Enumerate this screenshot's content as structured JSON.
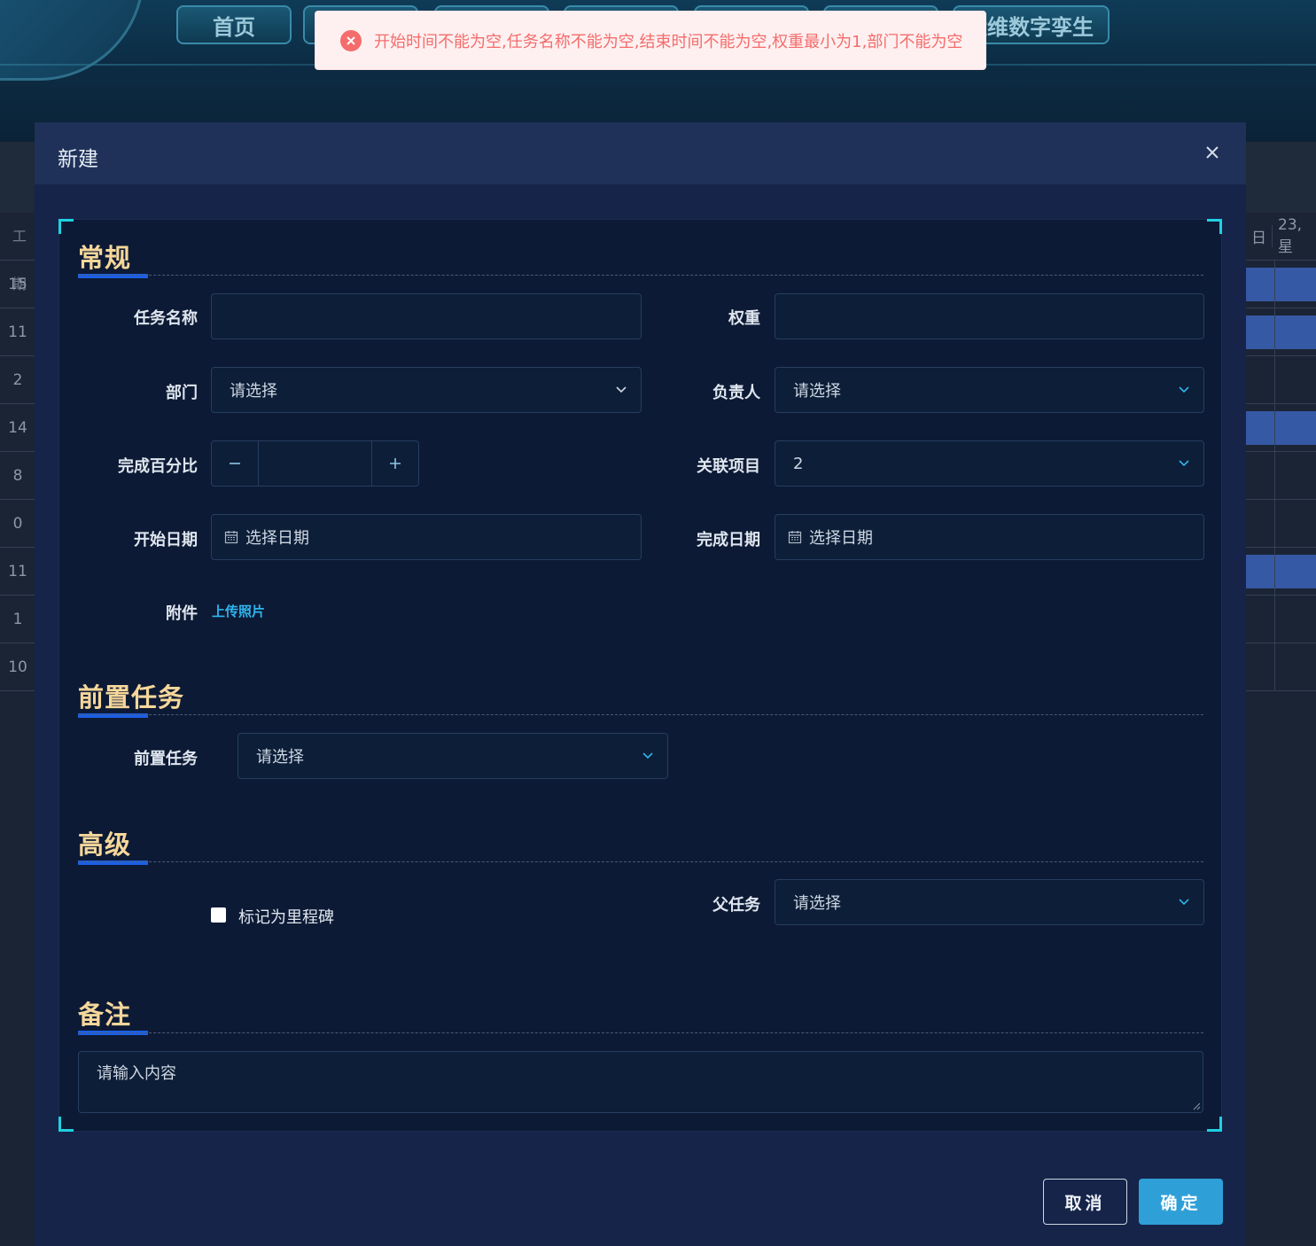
{
  "nav": {
    "tabs": [
      "首页",
      "",
      "",
      "",
      "",
      "",
      "运维数字孪生"
    ]
  },
  "background_table": {
    "left_header": "工期",
    "left_values": [
      "15",
      "11",
      "2",
      "14",
      "8",
      "0",
      "11",
      "1",
      "10"
    ],
    "right_header": [
      "日",
      "23, 星"
    ]
  },
  "toast": {
    "message": "开始时间不能为空,任务名称不能为空,结束时间不能为空,权重最小为1,部门不能为空",
    "color": "#f56c6c"
  },
  "dialog": {
    "title": "新建",
    "sections": {
      "general": "常规",
      "predecessor": "前置任务",
      "advanced": "高级",
      "remarks": "备注"
    },
    "fields": {
      "task_name": {
        "label": "任务名称",
        "value": ""
      },
      "weight": {
        "label": "权重",
        "value": ""
      },
      "department": {
        "label": "部门",
        "placeholder": "请选择"
      },
      "owner": {
        "label": "负责人",
        "placeholder": "请选择"
      },
      "percent": {
        "label": "完成百分比",
        "value": ""
      },
      "project": {
        "label": "关联项目",
        "value": "2"
      },
      "start_date": {
        "label": "开始日期",
        "placeholder": "选择日期"
      },
      "end_date": {
        "label": "完成日期",
        "placeholder": "选择日期"
      },
      "attachment": {
        "label": "附件",
        "link": "上传照片"
      },
      "predecessor": {
        "label": "前置任务",
        "placeholder": "请选择"
      },
      "milestone": {
        "label": "标记为里程碑",
        "checked": false
      },
      "parent_task": {
        "label": "父任务",
        "placeholder": "请选择"
      },
      "remarks": {
        "placeholder": "请输入内容"
      }
    },
    "buttons": {
      "cancel": "取消",
      "confirm": "确定"
    },
    "colors": {
      "accent": "#2f9fd8",
      "section_title": "#f6d79a",
      "corner": "#1fd1e0"
    }
  }
}
